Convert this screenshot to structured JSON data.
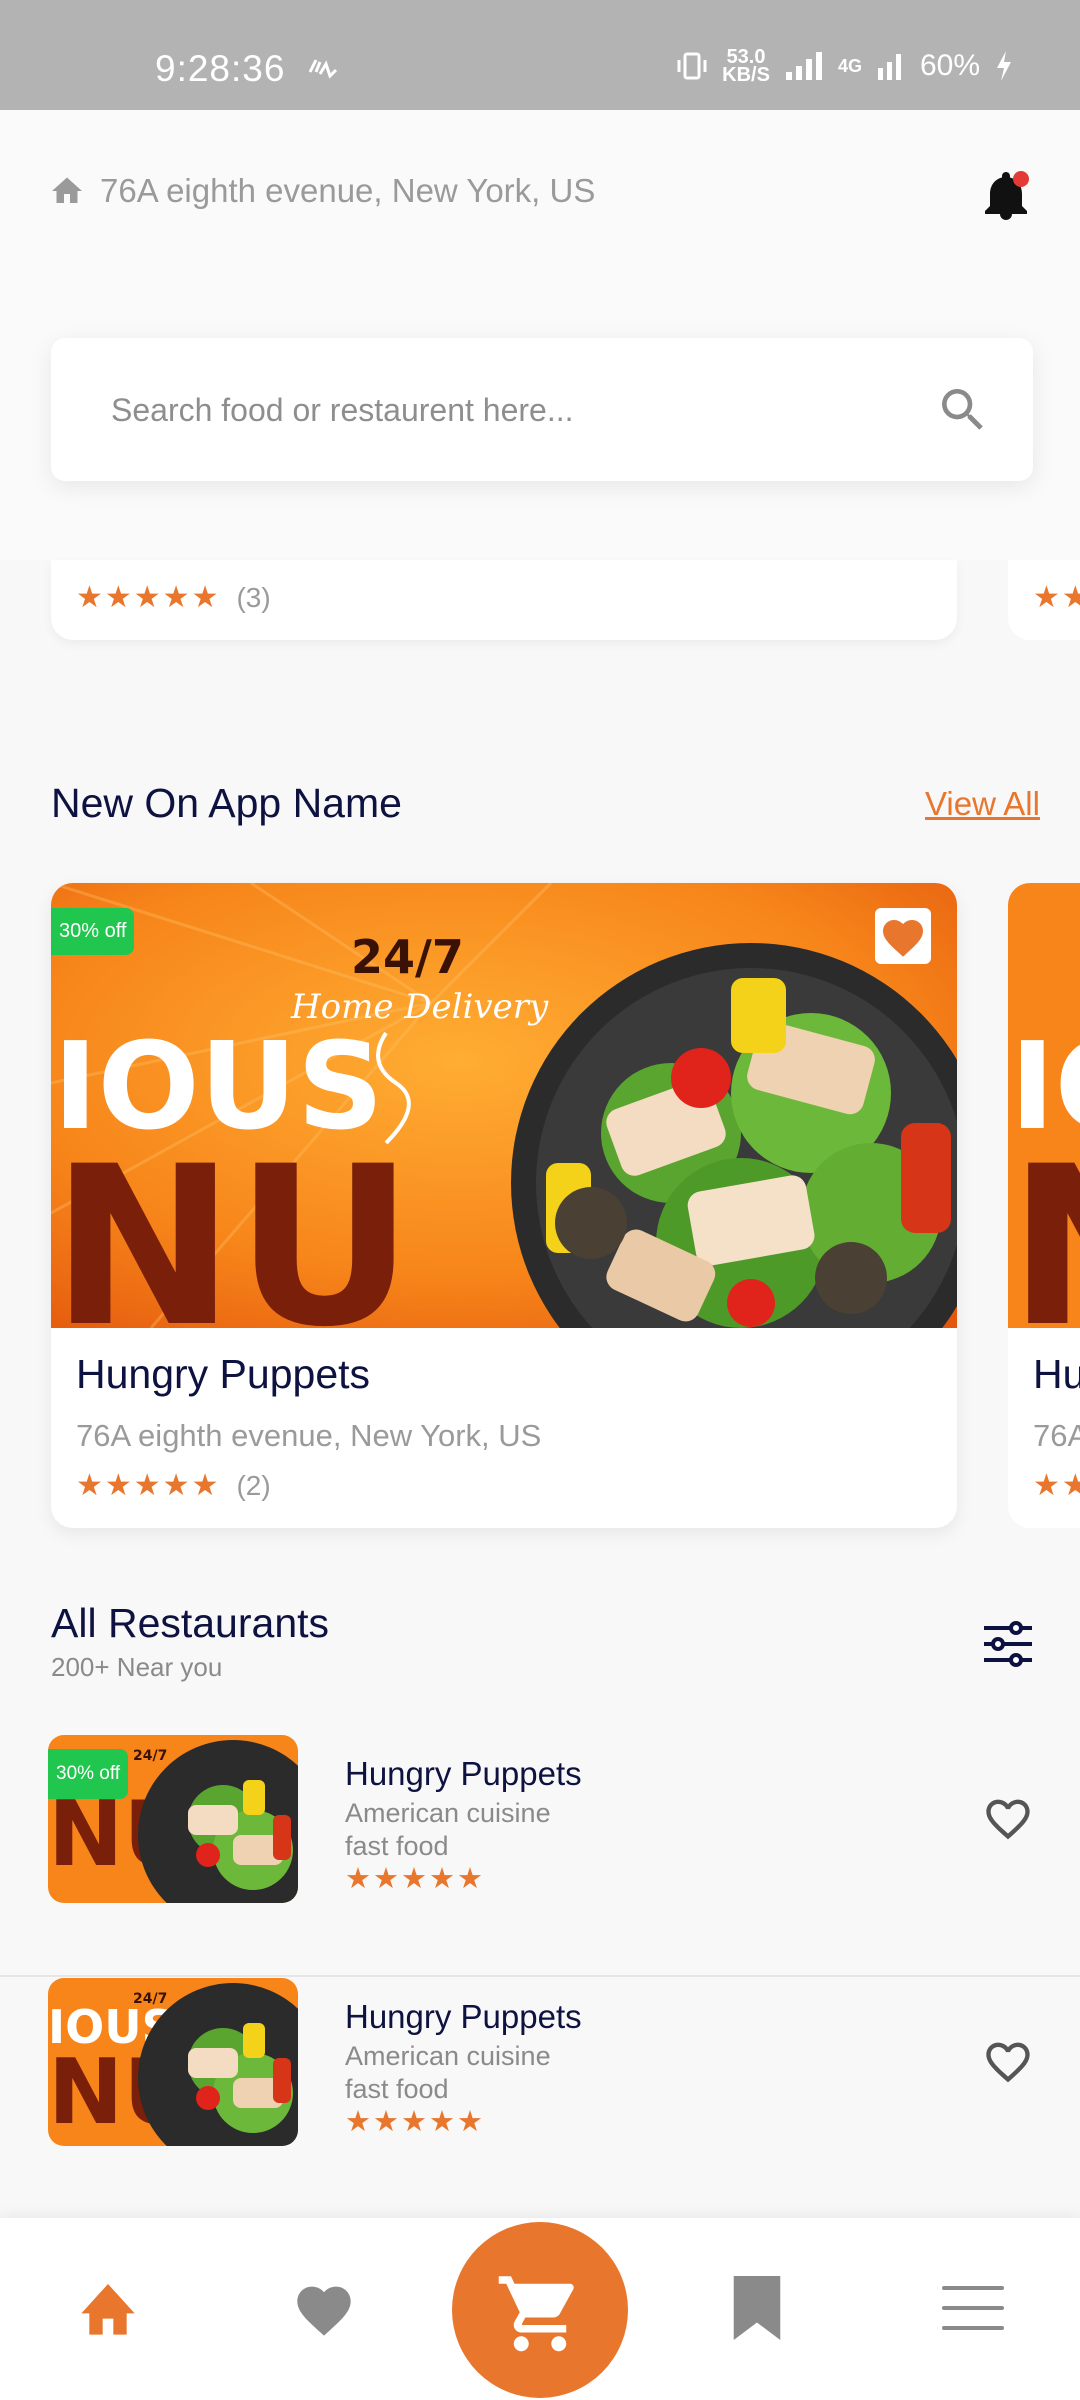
{
  "status_bar": {
    "time": "9:28:36",
    "speed_value": "53.0",
    "speed_unit": "KB/S",
    "network": "4G",
    "battery": "60%"
  },
  "header": {
    "address": "76A eighth evenue, New York, US",
    "search_placeholder": "Search food or restaurent here..."
  },
  "previous_card": {
    "stars": "★★★★★",
    "rating_count": "(3)"
  },
  "new_section": {
    "title": "New On App Name",
    "view_all": "View All",
    "featured": {
      "badge": "30% off",
      "name": "Hungry Puppets",
      "address": "76A eighth evenue, New York, US",
      "stars": "★★★★★",
      "rating_count": "(2)",
      "promo_text": "24/7",
      "promo_script": "Home Delivery",
      "promo_big_top": "IOUS",
      "promo_big_bottom": "NU"
    },
    "next_card": {
      "name": "Hu",
      "address": "76A",
      "stars": "★★"
    }
  },
  "all_restaurants": {
    "title": "All Restaurants",
    "subtitle": "200+ Near you",
    "items": [
      {
        "badge": "30% off",
        "name": "Hungry Puppets",
        "cuisine": "American cuisine",
        "type": "fast food",
        "stars": "★★★★★"
      },
      {
        "badge": "",
        "name": "Hungry Puppets",
        "cuisine": "American cuisine",
        "type": "fast food",
        "stars": "★★★★★"
      }
    ]
  },
  "colors": {
    "accent": "#e8762c",
    "badge_green": "#21c64f",
    "title_navy": "#0e1240",
    "status_bar": "#b3b3b3"
  },
  "icons": {
    "location": "home-icon",
    "notification": "bell-icon",
    "search": "search-icon",
    "filter": "filter-icon",
    "favorite": "heart-icon",
    "nav": [
      "home-icon",
      "heart-icon",
      "cart-icon",
      "bookmark-icon",
      "menu-icon"
    ]
  }
}
